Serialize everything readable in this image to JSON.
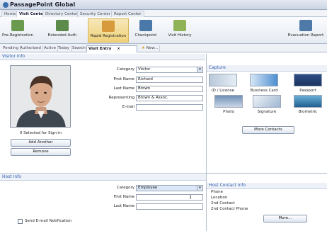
{
  "app": {
    "title": "PassagePoint Global"
  },
  "topnav": [
    "Home",
    "Visit Center",
    "Directory Center",
    "Security Center",
    "Report Center"
  ],
  "toolbar": [
    "Pre-Registration",
    "Extended Auth",
    "Rapid Registration",
    "Checkpoint",
    "Visit History",
    "Evacuation Report"
  ],
  "subtabs": [
    "Pending",
    "Authorized",
    "Active",
    "Today",
    "Search",
    "Visit Entry",
    "New..."
  ],
  "visitor_info": {
    "heading": "Visitor Info",
    "selected_text": "0 Selected for Sign-in",
    "add_button": "Add Another",
    "remove_button": "Remove",
    "fields": {
      "category_label": "Category",
      "category_value": "Visitor",
      "first_label": "First Name",
      "first_value": "Richard",
      "last_label": "Last Name",
      "last_value": "Brown",
      "rep_label": "Representing",
      "rep_value": "Brown & Assoc.",
      "email_label": "E-mail",
      "email_value": ""
    }
  },
  "capture": {
    "heading": "Capture",
    "items": [
      "ID / License",
      "Business Card",
      "Passport",
      "Photo",
      "Signature",
      "Biometric"
    ],
    "more_contacts": "More Contacts"
  },
  "host_info": {
    "heading": "Host Info",
    "category_label": "Category",
    "category_value": "Employee",
    "first_label": "First Name",
    "first_value": "",
    "last_label": "Last Name",
    "last_value": "",
    "send_email": "Send E-mail Notification",
    "contact_heading": "Host Contact Info",
    "contact_lines": [
      "Phone",
      "Location",
      "2nd Contact",
      "2nd Contact Phone"
    ],
    "more_button": "More..."
  }
}
